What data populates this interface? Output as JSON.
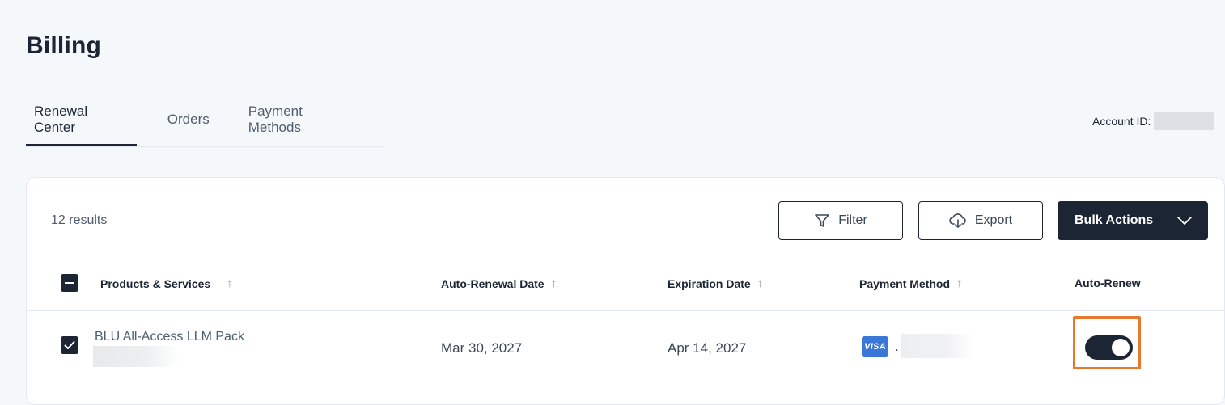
{
  "page": {
    "title": "Billing"
  },
  "tabs": [
    {
      "label": "Renewal Center",
      "active": true
    },
    {
      "label": "Orders",
      "active": false
    },
    {
      "label": "Payment Methods",
      "active": false
    }
  ],
  "account": {
    "label": "Account ID:"
  },
  "toolbar": {
    "results_count": "12 results",
    "filter_label": "Filter",
    "export_label": "Export",
    "bulk_label": "Bulk Actions"
  },
  "table": {
    "columns": [
      {
        "label": "Products & Services",
        "sortable": true
      },
      {
        "label": "Auto-Renewal Date",
        "sortable": true
      },
      {
        "label": "Expiration Date",
        "sortable": true
      },
      {
        "label": "Payment Method",
        "sortable": true
      },
      {
        "label": "Auto-Renew",
        "sortable": false
      }
    ],
    "sort_glyph": "↑",
    "rows": [
      {
        "selected": true,
        "product": "BLU All-Access LLM Pack",
        "auto_renewal_date": "Mar 30, 2027",
        "expiration_date": "Apr 14, 2027",
        "payment": {
          "brand": "VISA",
          "mask": "."
        },
        "auto_renew": true
      }
    ]
  },
  "colors": {
    "primary": "#1b2533",
    "background": "#f5f8fb",
    "visa": "#3a78d8",
    "highlight": "#e8782c"
  }
}
